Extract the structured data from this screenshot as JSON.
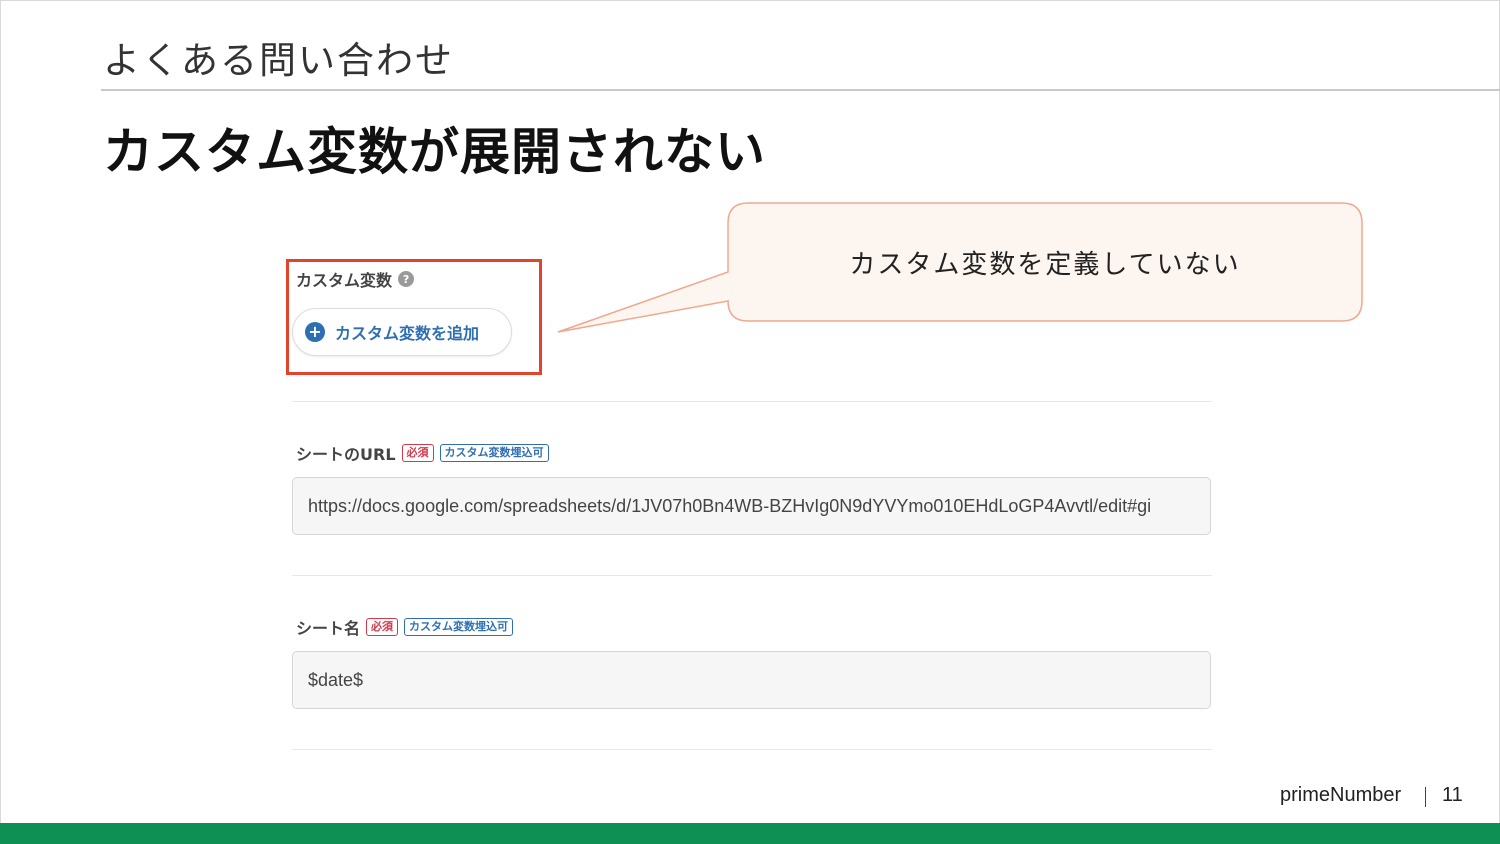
{
  "slide": {
    "section_title": "よくある問い合わせ",
    "title": "カスタム変数が展開されない",
    "brand": "primeNumber",
    "page_number": "11"
  },
  "colors": {
    "accent_bar": "#0e8f54",
    "highlight_border": "#e2432b",
    "callout_fill": "#fdf5f0",
    "callout_border": "#f0a88d",
    "link_blue": "#2e6fb3",
    "required_red": "#d23a4d"
  },
  "callout": {
    "text": "カスタム変数を定義していない"
  },
  "screenshot": {
    "custom_vars": {
      "label": "カスタム変数",
      "help_icon": "help-circle-icon",
      "add_button_label": "カスタム変数を追加",
      "add_icon": "plus-circle-icon"
    },
    "sheet_url": {
      "label": "シートのURL",
      "badge_required": "必須",
      "badge_var": "カスタム変数埋込可",
      "value": "https://docs.google.com/spreadsheets/d/1JV07h0Bn4WB-BZHvIg0N9dYVYmo010EHdLoGP4Avvtl/edit#gi"
    },
    "sheet_name": {
      "label": "シート名",
      "badge_required": "必須",
      "badge_var": "カスタム変数埋込可",
      "value": "$date$"
    }
  }
}
